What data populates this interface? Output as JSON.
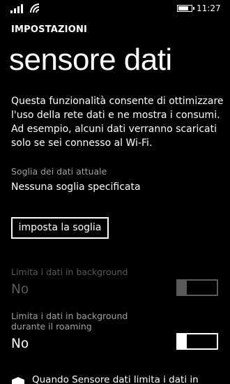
{
  "status_bar": {
    "signal_icon": "signal-bars-icon",
    "wifi_icon": "wifi-icon",
    "battery_icon": "battery-icon",
    "battery_level": 0.75,
    "time": "11:27"
  },
  "header": {
    "section": "IMPOSTAZIONI",
    "title": "sensore dati"
  },
  "description": {
    "lines": [
      "Questa funzionalità consente di ottimizzare",
      "l'uso della rete dati e ne mostra i consumi.",
      "Ad esempio, alcuni dati verranno scaricati",
      "solo se sei connesso al Wi-Fi."
    ]
  },
  "threshold": {
    "label": "Soglia dei dati attuale",
    "value": "Nessuna soglia specificata",
    "button_label": "imposta la soglia"
  },
  "background_limit": {
    "label": "Limita i dati in background",
    "value": "No",
    "enabled": false,
    "on": false
  },
  "roaming_limit": {
    "label_line1": "Limita i dati in background",
    "label_line2": "durante il roaming",
    "value": "No",
    "enabled": true,
    "on": false
  },
  "footer": {
    "icon": "shield-icon",
    "text": "Quando Sensore dati limita i dati in"
  }
}
